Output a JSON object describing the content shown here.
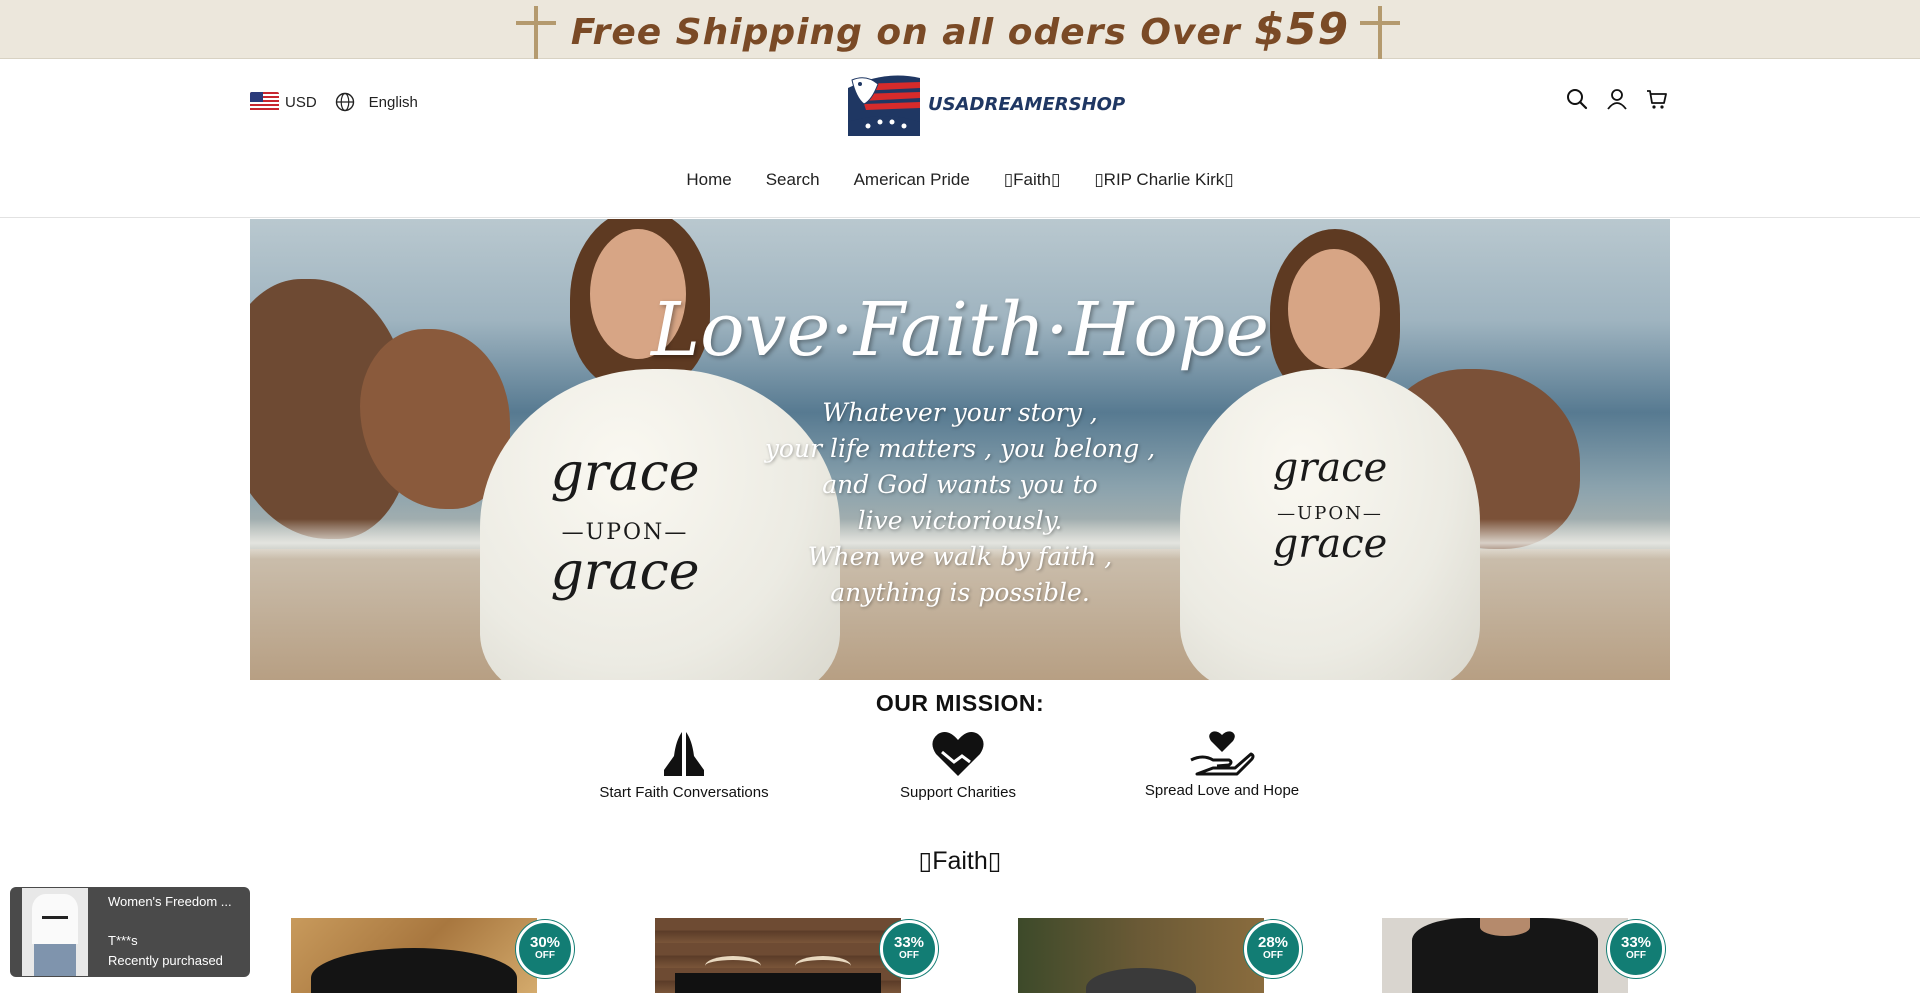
{
  "announcement": {
    "text_before_price": "Free Shipping on all oders Over",
    "price": "$59"
  },
  "header": {
    "currency": "USD",
    "language": "English",
    "logo_text": "USADREAMERSHOP",
    "icons": [
      "search-icon",
      "account-icon",
      "cart-icon"
    ]
  },
  "nav": {
    "items": [
      {
        "label": "Home"
      },
      {
        "label": "Search"
      },
      {
        "label": "American Pride"
      },
      {
        "label": "Faith"
      },
      {
        "label": "RIP Charlie Kirk"
      }
    ]
  },
  "hero": {
    "title": "Love·Faith·Hope",
    "body_lines": [
      "Whatever your story ,",
      "your life matters , you belong ,",
      "and God wants you to",
      "live victoriously.",
      "When we walk by faith ,",
      "anything is possible."
    ],
    "shirt_print": {
      "line1": "grace",
      "line2": "UPON",
      "line3": "grace"
    }
  },
  "mission": {
    "title": "OUR MISSION:",
    "items": [
      {
        "label": "Start Faith Conversations",
        "icon": "praying-hands-icon"
      },
      {
        "label": "Support Charities",
        "icon": "heart-handshake-icon"
      },
      {
        "label": "Spread Love and Hope",
        "icon": "hand-heart-icon"
      }
    ]
  },
  "section": {
    "title": "Faith"
  },
  "products": [
    {
      "discount": "30%",
      "off": "OFF"
    },
    {
      "discount": "33%",
      "off": "OFF"
    },
    {
      "discount": "28%",
      "off": "OFF"
    },
    {
      "discount": "33%",
      "off": "OFF"
    }
  ],
  "toast": {
    "product": "Women's Freedom ...",
    "buyer": "T***s",
    "status": "Recently purchased"
  },
  "colors": {
    "announcement_bg": "#ece7dc",
    "announcement_text": "#7a4a26",
    "badge": "#127d74",
    "logo_text": "#1f3763",
    "toast_bg": "#4a4a4a"
  }
}
